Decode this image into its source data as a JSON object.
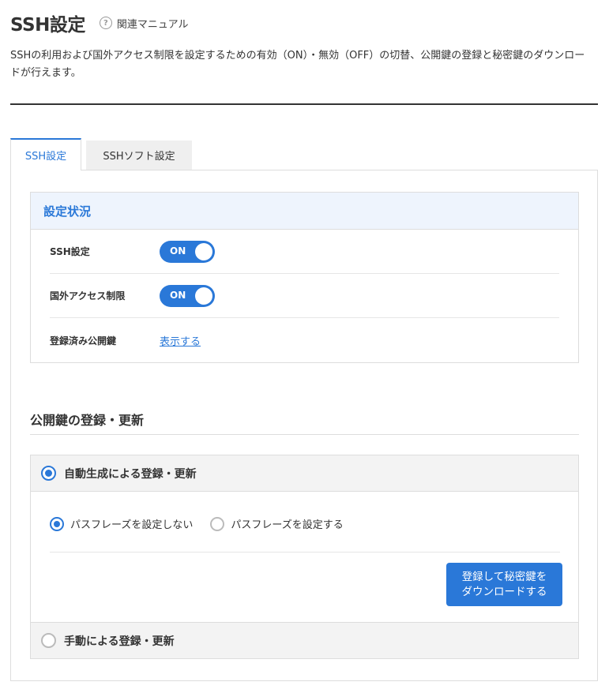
{
  "header": {
    "title": "SSH設定",
    "manual_link": "関連マニュアル",
    "help_icon": "?",
    "description": "SSHの利用および国外アクセス制限を設定するための有効（ON）・無効（OFF）の切替、公開鍵の登録と秘密鍵のダウンロードが行えます。"
  },
  "tabs": [
    {
      "label": "SSH設定",
      "active": true
    },
    {
      "label": "SSHソフト設定",
      "active": false
    }
  ],
  "status": {
    "title": "設定状況",
    "rows": [
      {
        "label": "SSH設定",
        "value": "ON"
      },
      {
        "label": "国外アクセス制限",
        "value": "ON"
      },
      {
        "label": "登録済み公開鍵",
        "link": "表示する"
      }
    ]
  },
  "registration": {
    "section_title": "公開鍵の登録・更新",
    "auto_option": "自動生成による登録・更新",
    "passphrase_options": [
      "パスフレーズを設定しない",
      "パスフレーズを設定する"
    ],
    "download_button": "登録して秘密鍵を\nダウンロードする",
    "manual_option": "手動による登録・更新"
  },
  "colors": {
    "accent": "#2a78d8",
    "status_head_bg": "#eef4fd",
    "option_bg": "#f3f3f3"
  }
}
